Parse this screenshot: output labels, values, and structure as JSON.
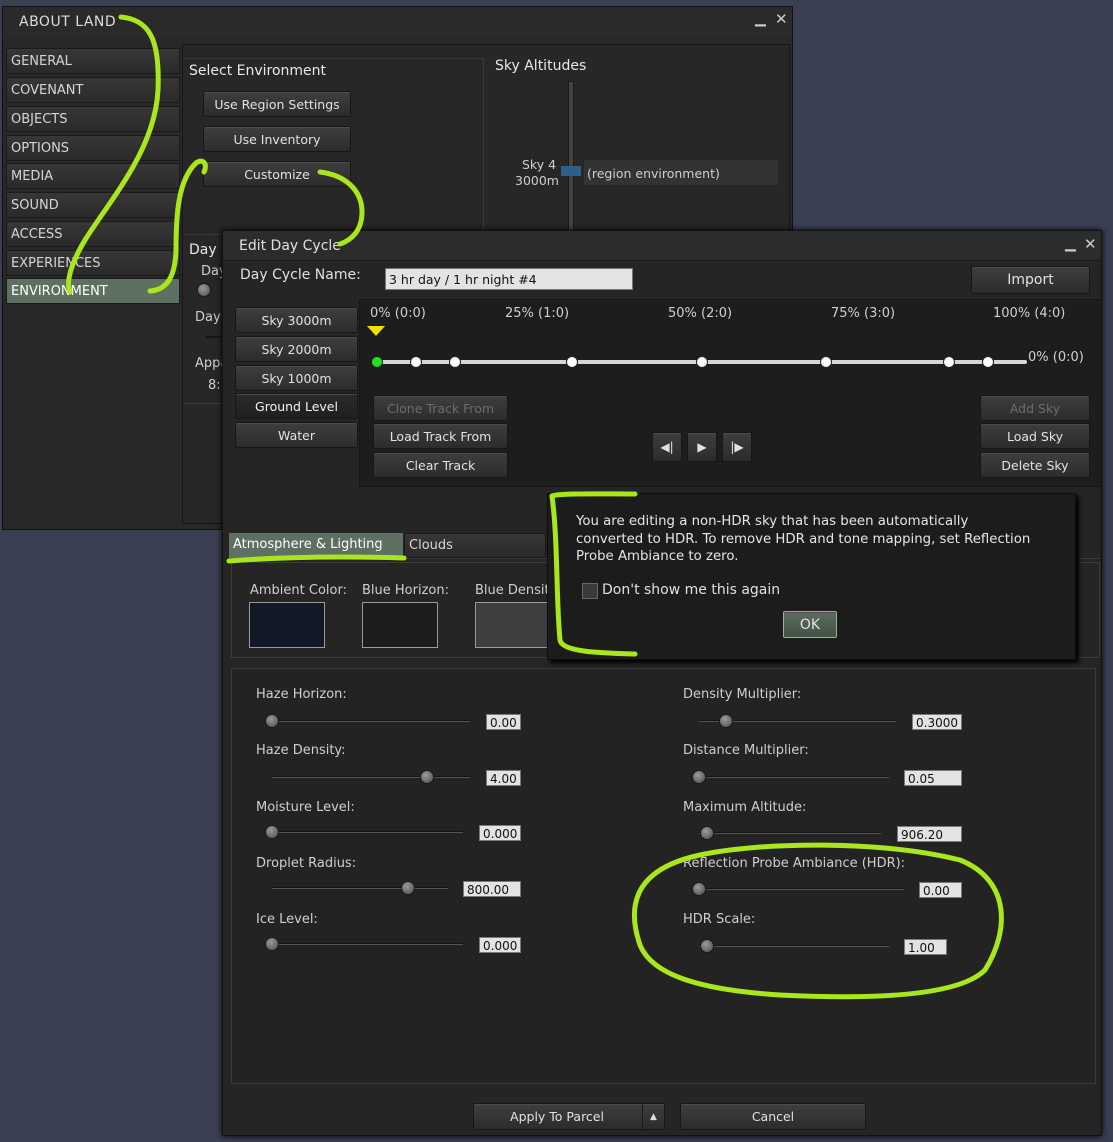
{
  "about_land": {
    "title": "ABOUT LAND",
    "tabs": [
      "GENERAL",
      "COVENANT",
      "OBJECTS",
      "OPTIONS",
      "MEDIA",
      "SOUND",
      "ACCESS",
      "EXPERIENCES",
      "ENVIRONMENT"
    ],
    "selected_tab": "ENVIRONMENT",
    "select_environment": {
      "heading": "Select Environment",
      "use_region_settings": "Use Region Settings",
      "use_inventory": "Use Inventory",
      "customize": "Customize"
    },
    "sky_altitudes": {
      "heading": "Sky Altitudes",
      "sky_label": "Sky 4",
      "sky_altitude": "3000m",
      "environment_label": "(region environment)"
    },
    "partial_labels": {
      "day": "Day",
      "day_short": "Day",
      "day2": "Day",
      "appa": "Appa",
      "time": "8:"
    }
  },
  "edit_day_cycle": {
    "title": "Edit Day Cycle",
    "name_label": "Day Cycle Name:",
    "name_value": "3 hr day / 1 hr night #4",
    "import": "Import",
    "tracks": [
      "Sky 3000m",
      "Sky 2000m",
      "Sky 1000m",
      "Ground Level",
      "Water"
    ],
    "active_track": "Ground Level",
    "timeline_labels": [
      "0% (0:0)",
      "25% (1:0)",
      "50% (2:0)",
      "75% (3:0)",
      "100% (4:0)"
    ],
    "end_label": "0% (0:0)",
    "keyframes": [
      0.0,
      0.06,
      0.12,
      0.3,
      0.5,
      0.69,
      0.88,
      0.94
    ],
    "selected_keyframe": 0.0,
    "track_buttons": {
      "clone": "Clone Track From",
      "load": "Load Track From",
      "clear": "Clear Track"
    },
    "sky_buttons": {
      "add": "Add Sky",
      "load": "Load Sky",
      "delete": "Delete Sky"
    },
    "tabs": {
      "atmosphere": "Atmosphere & Lighting",
      "clouds": "Clouds"
    },
    "swatches": {
      "ambient": {
        "label": "Ambient Color:",
        "color": "#121826"
      },
      "blue_horizon": {
        "label": "Blue Horizon:",
        "color": "#1b1c1e"
      },
      "blue_density": {
        "label": "Blue Densit",
        "color": "#3d3e40"
      }
    },
    "sliders_left": [
      {
        "label": "Haze Horizon:",
        "value": "0.00",
        "level": 0.0
      },
      {
        "label": "Haze Density:",
        "value": "4.00",
        "level": 0.8
      },
      {
        "label": "Moisture Level:",
        "value": "0.000",
        "level": 0.0
      },
      {
        "label": "Droplet Radius:",
        "value": "800.00",
        "level": 0.8
      },
      {
        "label": "Ice Level:",
        "value": "0.000",
        "level": 0.0
      }
    ],
    "sliders_right": [
      {
        "label": "Density Multiplier:",
        "value": "0.3000",
        "level": 0.15
      },
      {
        "label": "Distance Multiplier:",
        "value": "0.05",
        "level": 0.0
      },
      {
        "label": "Maximum Altitude:",
        "value": "906.20",
        "level": 0.05
      },
      {
        "label": "Reflection Probe Ambiance (HDR):",
        "value": "0.00",
        "level": 0.0
      },
      {
        "label": "HDR Scale:",
        "value": "1.00",
        "level": 0.0
      }
    ],
    "apply": "Apply To Parcel",
    "cancel": "Cancel"
  },
  "notification": {
    "message": "You are editing a non-HDR sky that has been automatically converted to HDR. To remove HDR and tone mapping, set Reflection Probe Ambiance to zero.",
    "checkbox_label": "Don't show me this again",
    "ok": "OK"
  },
  "colors": {
    "highlight": "#a8e61d",
    "selected_tab": "#5d7062",
    "keyframe_selected": "#22e022",
    "marker": "#f0e000"
  }
}
